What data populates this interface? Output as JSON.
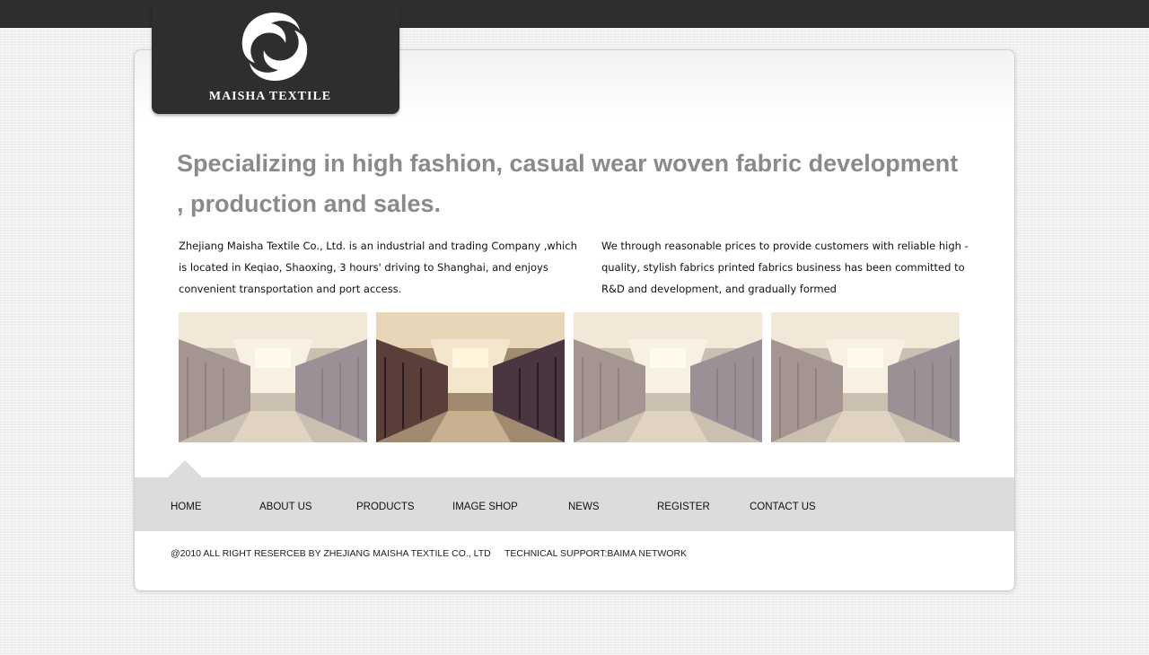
{
  "brand": {
    "name": "MAISHA TEXTILE",
    "logo_icon": "swirl-logo-icon"
  },
  "headline": "Specializing in high fashion, casual wear woven fabric development , production and sales.",
  "intro": {
    "left": "Zhejiang Maisha Textile Co., Ltd. is an industrial and trading Company ,which is located in Keqiao, Shaoxing, 3 hours' driving to Shanghai, and enjoys convenient transportation and port access.",
    "right": "We through reasonable prices to provide customers with reliable high -quality, stylish fabrics printed fabrics business has been committed to R&D and development, and gradually formed"
  },
  "gallery": [
    {
      "name": "showroom-photo-1",
      "active": false
    },
    {
      "name": "showroom-photo-2",
      "active": true
    },
    {
      "name": "showroom-photo-3",
      "active": false
    },
    {
      "name": "showroom-photo-4",
      "active": false
    }
  ],
  "nav": {
    "items": [
      {
        "label": "HOME"
      },
      {
        "label": "ABOUT US"
      },
      {
        "label": "PRODUCTS"
      },
      {
        "label": "IMAGE SHOP"
      },
      {
        "label": "NEWS"
      },
      {
        "label": "REGISTER"
      },
      {
        "label": "CONTACT US"
      }
    ]
  },
  "footer": {
    "copyright": "@2010 ALL RIGHT RESERCEB BY ZHEJIANG MAISHA TEXTILE CO., LTD",
    "support": "TECHNICAL SUPPORT:BAIMA NETWORK"
  },
  "colors": {
    "topbar": "#2f2f2f",
    "logo_bg": "#2e2e2e",
    "headline": "#8a8a8a",
    "nav_bg": "#dcdcdc"
  }
}
